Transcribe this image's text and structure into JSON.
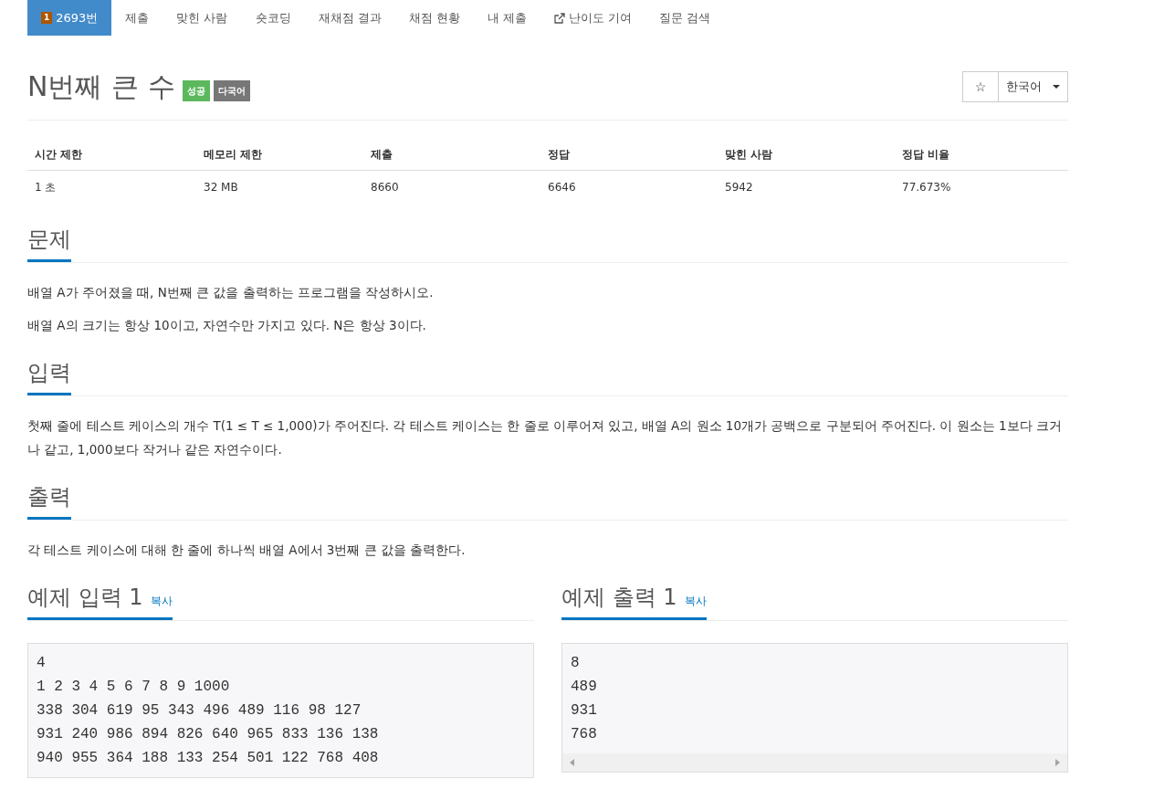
{
  "nav": [
    {
      "label": "2693번",
      "badge": "1",
      "kind": "problem",
      "selected": true
    },
    {
      "label": "제출",
      "kind": "plain",
      "selected": false
    },
    {
      "label": "맞힌 사람",
      "kind": "plain",
      "selected": false
    },
    {
      "label": "숏코딩",
      "kind": "plain",
      "selected": false
    },
    {
      "label": "재채점 결과",
      "kind": "plain",
      "selected": false
    },
    {
      "label": "채점 현황",
      "kind": "plain",
      "selected": false
    },
    {
      "label": "내 제출",
      "kind": "plain",
      "selected": false
    },
    {
      "label": "난이도 기여",
      "kind": "external",
      "selected": false
    },
    {
      "label": "질문 검색",
      "kind": "plain",
      "selected": false
    }
  ],
  "title": "N번째 큰 수",
  "labels": [
    {
      "text": "성공",
      "color": "#5cb85c"
    },
    {
      "text": "다국어",
      "color": "#777777"
    }
  ],
  "star": "☆",
  "language": "한국어",
  "stats": {
    "columns": [
      "시간 제한",
      "메모리 제한",
      "제출",
      "정답",
      "맞힌 사람",
      "정답 비율"
    ],
    "row": [
      "1 초",
      "32 MB",
      "8660",
      "6646",
      "5942",
      "77.673%"
    ]
  },
  "sections": [
    {
      "heading": "문제",
      "paragraphs": [
        "배열 A가 주어졌을 때, N번째 큰 값을 출력하는 프로그램을 작성하시오.",
        "배열 A의 크기는 항상 10이고, 자연수만 가지고 있다. N은 항상 3이다."
      ]
    },
    {
      "heading": "입력",
      "paragraphs": [
        "첫째 줄에 테스트 케이스의 개수 T(1 ≤ T ≤ 1,000)가 주어진다. 각 테스트 케이스는 한 줄로 이루어져 있고, 배열 A의 원소 10개가 공백으로 구분되어 주어진다. 이 원소는 1보다 크거나 같고, 1,000보다 작거나 같은 자연수이다."
      ]
    },
    {
      "heading": "출력",
      "paragraphs": [
        "각 테스트 케이스에 대해 한 줄에 하나씩 배열 A에서 3번째 큰 값을 출력한다."
      ]
    }
  ],
  "samples": [
    {
      "heading": "예제 입력 1",
      "copy": "복사",
      "lines": [
        "4",
        "1 2 3 4 5 6 7 8 9 1000",
        "338 304 619 95 343 496 489 116 98 127",
        "931 240 986 894 826 640 965 833 136 138",
        "940 955 364 188 133 254 501 122 768 408"
      ],
      "scrollbar": false
    },
    {
      "heading": "예제 출력 1",
      "copy": "복사",
      "lines": [
        "8",
        "489",
        "931",
        "768"
      ],
      "scrollbar": true
    }
  ]
}
